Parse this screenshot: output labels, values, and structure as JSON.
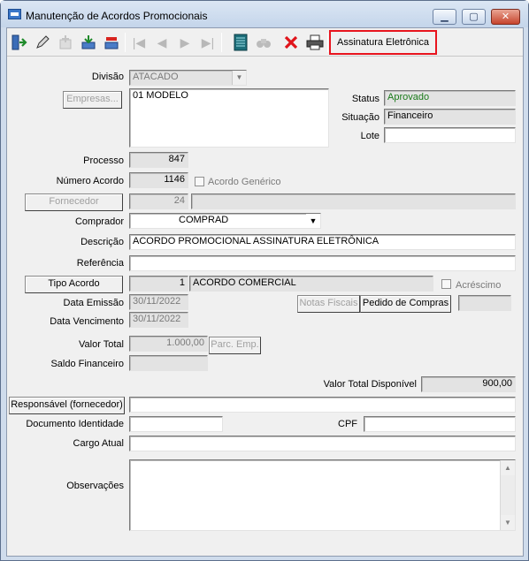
{
  "window": {
    "title": "Manutenção de Acordos Promocionais",
    "minimize": "▁",
    "maximize": "▢",
    "close": "✕"
  },
  "toolbar": {
    "icons": [
      "exit-icon",
      "edit-icon",
      "add-icon",
      "save-icon",
      "cancel-edit-icon",
      "first-record-icon",
      "previous-record-icon",
      "next-record-icon",
      "last-record-icon",
      "list-icon",
      "find-icon",
      "delete-icon",
      "print-icon"
    ],
    "signature_button": "Assinatura Eletrônica",
    "accent_color": "#e8141e"
  },
  "form": {
    "divisao": {
      "label": "Divisão",
      "value": "ATACADO"
    },
    "empresas": {
      "button": "Empresas...",
      "value": "01 MODELO"
    },
    "status": {
      "label": "Status",
      "value": "Aprovado",
      "color": "#1a7a1a"
    },
    "situacao": {
      "label": "Situação",
      "value": "Financeiro"
    },
    "lote": {
      "label": "Lote",
      "value": ""
    },
    "processo": {
      "label": "Processo",
      "value": "847"
    },
    "numero_acordo": {
      "label": "Número Acordo",
      "value": "1146"
    },
    "acordo_generico": {
      "label": "Acordo Genérico",
      "checked": false
    },
    "fornecedor": {
      "button": "Fornecedor",
      "code": "24",
      "name": ""
    },
    "comprador": {
      "label": "Comprador",
      "value": "COMPRAD"
    },
    "descricao": {
      "label": "Descrição",
      "value": "ACORDO PROMOCIONAL ASSINATURA ELETRÔNICA"
    },
    "referencia": {
      "label": "Referência",
      "value": ""
    },
    "tipo_acordo": {
      "button": "Tipo Acordo",
      "code": "1",
      "name": "ACORDO COMERCIAL"
    },
    "acrescimo": {
      "label": "Acréscimo",
      "checked": false
    },
    "data_emissao": {
      "label": "Data Emissão",
      "value": "30/11/2022"
    },
    "data_vencimento": {
      "label": "Data Vencimento",
      "value": "30/11/2022"
    },
    "notas_fiscais": {
      "button": "Notas Fiscais"
    },
    "pedido_compras": {
      "button": "Pedido de Compras",
      "value": ""
    },
    "valor_total": {
      "label": "Valor Total",
      "value": "1.000,00"
    },
    "parc_emp": {
      "button": "Parc. Emp."
    },
    "saldo_financeiro": {
      "label": "Saldo Financeiro",
      "value": ""
    },
    "valor_total_disponivel": {
      "label": "Valor Total Disponível",
      "value": "900,00"
    },
    "responsavel": {
      "button": "Responsável (fornecedor)",
      "value": ""
    },
    "documento_identidade": {
      "label": "Documento Identidade",
      "value": ""
    },
    "cpf": {
      "label": "CPF",
      "value": ""
    },
    "cargo_atual": {
      "label": "Cargo Atual",
      "value": ""
    },
    "observacoes": {
      "label": "Observações",
      "value": ""
    }
  }
}
